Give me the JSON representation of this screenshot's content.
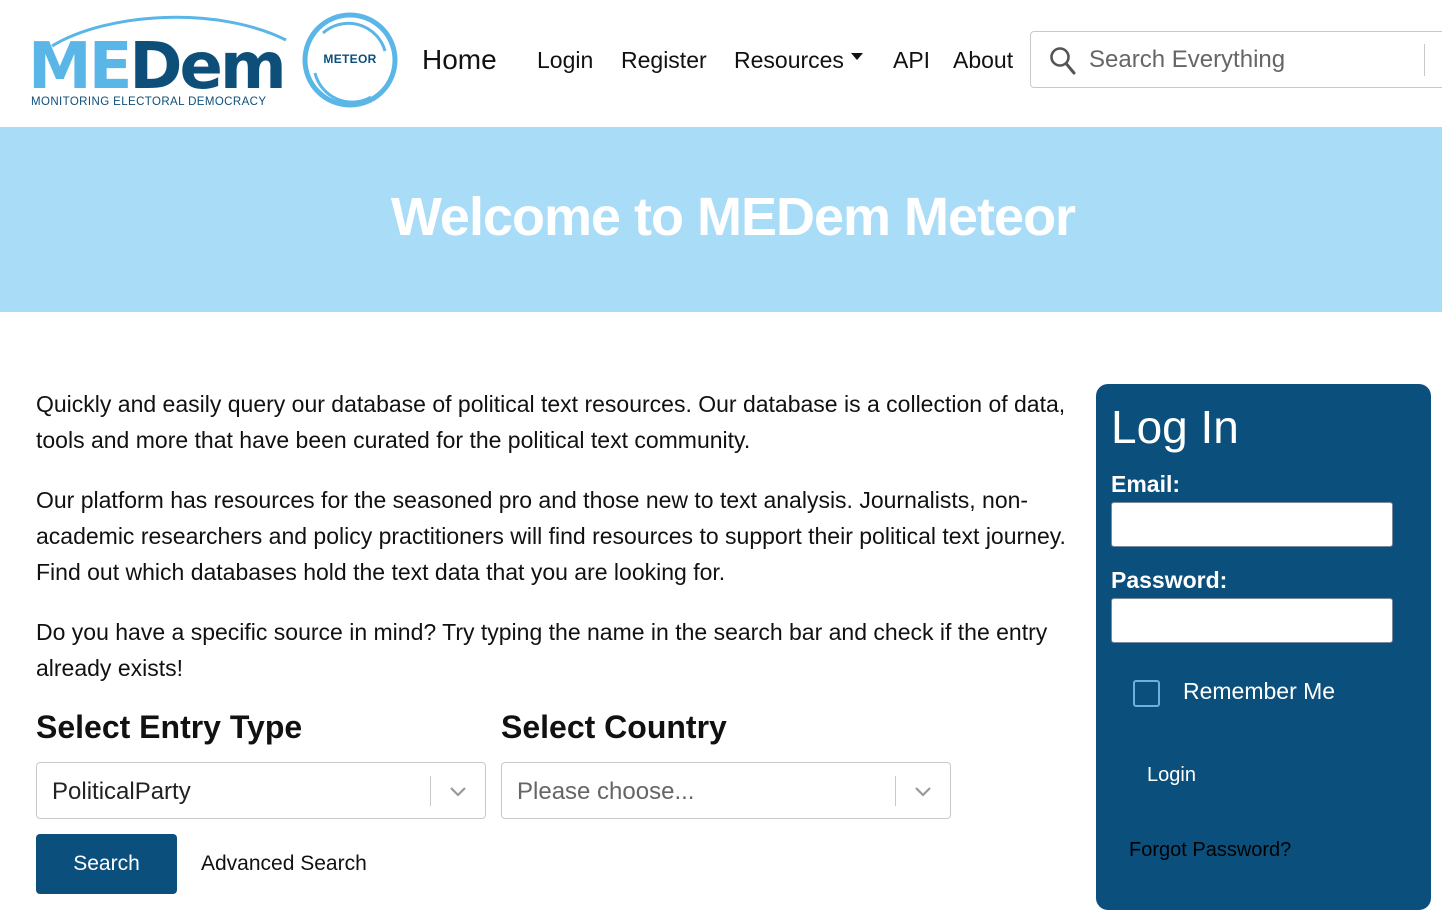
{
  "logo": {
    "medem_me": "ME",
    "medem_dem": "Dem",
    "subtitle": "MONITORING ELECTORAL DEMOCRACY",
    "meteor": "METEOR"
  },
  "nav": {
    "home": "Home",
    "login": "Login",
    "register": "Register",
    "resources": "Resources",
    "api": "API",
    "about": "About"
  },
  "search": {
    "placeholder": "Search Everything"
  },
  "hero": {
    "title": "Welcome to MEDem Meteor"
  },
  "intro": {
    "p1": "Quickly and easily query our database of political text resources. Our database is a collection of data, tools and more that have been curated for the political text community.",
    "p2": "Our platform has resources for the seasoned pro and those new to text analysis. Journalists, non-academic researchers and policy practitioners will find resources to support their political text journey. Find out which databases hold the text data that you are looking for.",
    "p3": "Do you have a specific source in mind? Try typing the name in the search bar and check if the entry already exists!"
  },
  "filters": {
    "entry_type_label": "Select Entry Type",
    "entry_type_value": "PoliticalParty",
    "country_label": "Select Country",
    "country_placeholder": "Please choose...",
    "search_button": "Search",
    "advanced_search": "Advanced Search"
  },
  "login_panel": {
    "title": "Log In",
    "email_label": "Email:",
    "password_label": "Password:",
    "remember_me": "Remember Me",
    "login_button": "Login",
    "forgot_password": "Forgot Password?"
  },
  "colors": {
    "brand_dark": "#0b4f7d",
    "brand_light": "#5bb6e8",
    "hero_bg": "#a9dcf7"
  }
}
